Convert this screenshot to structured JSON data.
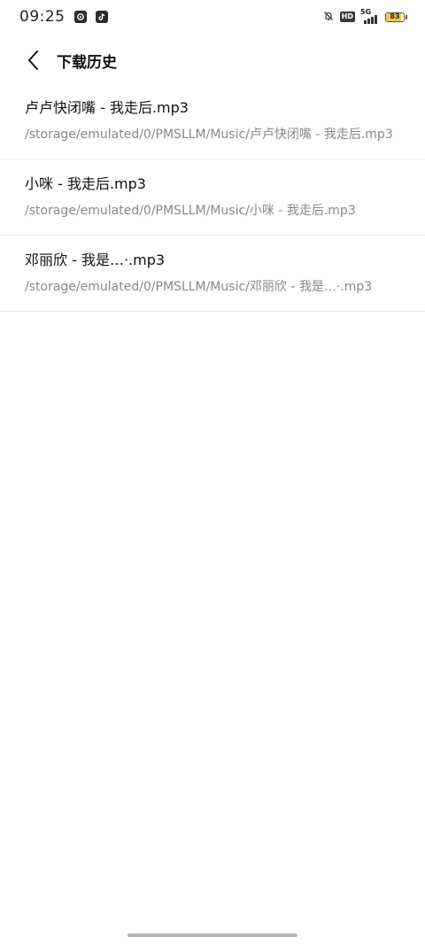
{
  "status_bar": {
    "time": "09:25",
    "hd_label": "HD",
    "network_label": "5G",
    "battery_level": "83"
  },
  "header": {
    "title": "下载历史"
  },
  "history": [
    {
      "name": "卢卢快闭嘴 - 我走后.mp3",
      "path": "/storage/emulated/0/PMSLLM/Music/卢卢快闭嘴 - 我走后.mp3"
    },
    {
      "name": "小咪 - 我走后.mp3",
      "path": "/storage/emulated/0/PMSLLM/Music/小咪 - 我走后.mp3"
    },
    {
      "name": "邓丽欣 - 我是…·.mp3",
      "path": "/storage/emulated/0/PMSLLM/Music/邓丽欣 - 我是…·.mp3"
    }
  ],
  "colors": {
    "accent_battery": "#f2c94c",
    "secondary_text": "#888888",
    "divider": "#ececec"
  }
}
